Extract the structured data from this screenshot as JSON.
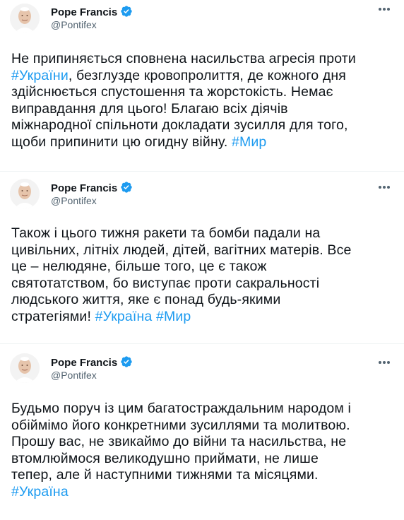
{
  "tweets": [
    {
      "author": "Pope Francis",
      "handle": "@Pontifex",
      "text_parts": [
        "Не припиняється сповнена насильства агресія проти\n",
        "#України",
        ", безглузде кровопролиття, де кожного дня\nздійснюється спустошення та жорстокість. Немає\nвиправдання для цього! Благаю всіх діячів\nміжнародної спільноти докладати зусилля для того,\nщоби припинити цю огидну війну. ",
        "#Мир"
      ]
    },
    {
      "author": "Pope Francis",
      "handle": "@Pontifex",
      "text_parts": [
        "Також і цього тижня ракети та бомби падали на\nцивільних, літніх людей, дітей, вагітних матерів. Все\nце – нелюдяне, більше того, це є також\nсвятотатством, бо виступає проти сакральності\nлюдського життя, яке є понад будь-якими\nстратегіями! ",
        "#Україна",
        " ",
        "#Мир"
      ]
    },
    {
      "author": "Pope Francis",
      "handle": "@Pontifex",
      "text_parts": [
        "Будьмо поруч із цим багатостраждальним народом і\nобіймімо його конкретними зусиллями та молитвою.\nПрошу вас, не звикаймо до війни та насильства, не\nвтомлюймося великодушно приймати, не лише\nтепер, але й наступними тижнями та місяцями.\n",
        "#Україна"
      ]
    }
  ],
  "colors": {
    "hashtag": "#1d9bf0",
    "verified": "#1d9bf0",
    "handle": "#536471",
    "text": "#0f1419"
  },
  "icons": {
    "verified": "verified-badge-icon",
    "more": "more-options-icon"
  }
}
